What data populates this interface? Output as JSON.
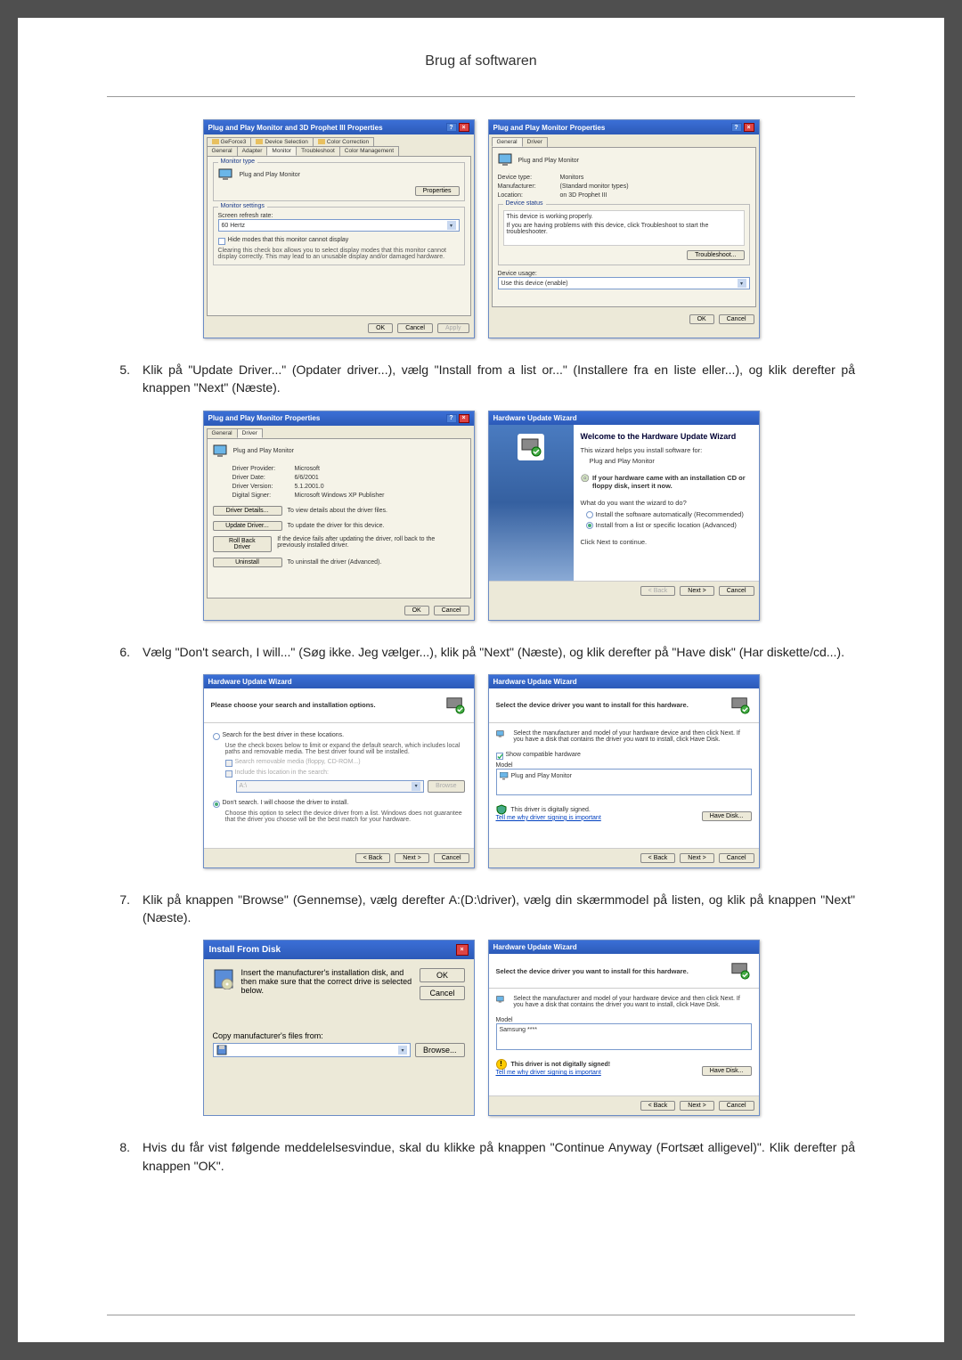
{
  "page": {
    "title": "Brug af softwaren"
  },
  "steps": {
    "s5": {
      "num": "5.",
      "text": "Klik på \"Update Driver...\" (Opdater driver...), vælg \"Install from a list or...\" (Installere fra en liste eller...), og klik derefter på knappen \"Next\" (Næste)."
    },
    "s6": {
      "num": "6.",
      "text": "Vælg \"Don't search, I will...\" (Søg ikke. Jeg vælger...), klik på \"Next\" (Næste), og klik derefter på \"Have disk\" (Har diskette/cd...)."
    },
    "s7": {
      "num": "7.",
      "text": "Klik på knappen \"Browse\" (Gennemse), vælg derefter A:(D:\\driver), vælg din skærmmodel på listen, og klik på knappen \"Next\" (Næste)."
    },
    "s8": {
      "num": "8.",
      "text": "Hvis du får vist følgende meddelelsesvindue, skal du klikke på knappen \"Continue Anyway (Fortsæt alligevel)\". Klik derefter på knappen \"OK\"."
    }
  },
  "fig1": {
    "left": {
      "title": "Plug and Play Monitor and 3D Prophet III Properties",
      "tabs": {
        "geforce": "GeForce3",
        "device_sel": "Device Selection",
        "color_corr": "Color Correction",
        "general": "General",
        "adapter": "Adapter",
        "monitor": "Monitor",
        "troubleshoot": "Troubleshoot",
        "color_mgmt": "Color Management"
      },
      "monitor_type_legend": "Monitor type",
      "monitor_name": "Plug and Play Monitor",
      "properties_btn": "Properties",
      "monitor_settings_legend": "Monitor settings",
      "refresh_label": "Screen refresh rate:",
      "refresh_value": "60 Hertz",
      "hide_modes": "Hide modes that this monitor cannot display",
      "hide_modes_note": "Clearing this check box allows you to select display modes that this monitor cannot display correctly. This may lead to an unusable display and/or damaged hardware.",
      "ok": "OK",
      "cancel": "Cancel",
      "apply": "Apply"
    },
    "right": {
      "title": "Plug and Play Monitor Properties",
      "tab_general": "General",
      "tab_driver": "Driver",
      "header": "Plug and Play Monitor",
      "devtype_lbl": "Device type:",
      "devtype_val": "Monitors",
      "manuf_lbl": "Manufacturer:",
      "manuf_val": "(Standard monitor types)",
      "loc_lbl": "Location:",
      "loc_val": "on 3D Prophet III",
      "status_legend": "Device status",
      "status_line1": "This device is working properly.",
      "status_line2": "If you are having problems with this device, click Troubleshoot to start the troubleshooter.",
      "troubleshoot_btn": "Troubleshoot...",
      "usage_lbl": "Device usage:",
      "usage_val": "Use this device (enable)",
      "ok": "OK",
      "cancel": "Cancel"
    }
  },
  "fig2": {
    "left": {
      "title": "Plug and Play Monitor Properties",
      "tab_general": "General",
      "tab_driver": "Driver",
      "header": "Plug and Play Monitor",
      "provider_lbl": "Driver Provider:",
      "provider_val": "Microsoft",
      "date_lbl": "Driver Date:",
      "date_val": "6/6/2001",
      "version_lbl": "Driver Version:",
      "version_val": "5.1.2001.0",
      "signer_lbl": "Digital Signer:",
      "signer_val": "Microsoft Windows XP Publisher",
      "details_btn": "Driver Details...",
      "details_txt": "To view details about the driver files.",
      "update_btn": "Update Driver...",
      "update_txt": "To update the driver for this device.",
      "rollback_btn": "Roll Back Driver",
      "rollback_txt": "If the device fails after updating the driver, roll back to the previously installed driver.",
      "uninstall_btn": "Uninstall",
      "uninstall_txt": "To uninstall the driver (Advanced).",
      "ok": "OK",
      "cancel": "Cancel"
    },
    "right": {
      "title": "Hardware Update Wizard",
      "welcome": "Welcome to the Hardware Update Wizard",
      "helps": "This wizard helps you install software for:",
      "device": "Plug and Play Monitor",
      "cd_hint": "If your hardware came with an installation CD or floppy disk, insert it now.",
      "question": "What do you want the wizard to do?",
      "opt_auto": "Install the software automatically (Recommended)",
      "opt_list": "Install from a list or specific location (Advanced)",
      "continue": "Click Next to continue.",
      "back": "< Back",
      "next": "Next >",
      "cancel": "Cancel"
    }
  },
  "fig3": {
    "left": {
      "title": "Hardware Update Wizard",
      "header": "Please choose your search and installation options.",
      "opt_search": "Search for the best driver in these locations.",
      "search_note": "Use the check boxes below to limit or expand the default search, which includes local paths and removable media. The best driver found will be installed.",
      "chk_removable": "Search removable media (floppy, CD-ROM...)",
      "chk_include": "Include this location in the search:",
      "path": "A:\\",
      "browse": "Browse",
      "opt_dont": "Don't search. I will choose the driver to install.",
      "dont_note": "Choose this option to select the device driver from a list. Windows does not guarantee that the driver you choose will be the best match for your hardware.",
      "back": "< Back",
      "next": "Next >",
      "cancel": "Cancel"
    },
    "right": {
      "title": "Hardware Update Wizard",
      "header": "Select the device driver you want to install for this hardware.",
      "instr": "Select the manufacturer and model of your hardware device and then click Next. If you have a disk that contains the driver you want to install, click Have Disk.",
      "show_compat": "Show compatible hardware",
      "model_lbl": "Model",
      "model_item": "Plug and Play Monitor",
      "signed": "This driver is digitally signed.",
      "tellme": "Tell me why driver signing is important",
      "have_disk": "Have Disk...",
      "back": "< Back",
      "next": "Next >",
      "cancel": "Cancel"
    }
  },
  "fig4": {
    "left": {
      "title": "Install From Disk",
      "instr": "Insert the manufacturer's installation disk, and then make sure that the correct drive is selected below.",
      "ok": "OK",
      "cancel": "Cancel",
      "copy_lbl": "Copy manufacturer's files from:",
      "path_val": "",
      "browse": "Browse..."
    },
    "right": {
      "title": "Hardware Update Wizard",
      "header": "Select the device driver you want to install for this hardware.",
      "instr": "Select the manufacturer and model of your hardware device and then click Next. If you have a disk that contains the driver you want to install, click Have Disk.",
      "model_lbl": "Model",
      "model_item": "Samsung ****",
      "not_signed": "This driver is not digitally signed!",
      "tellme": "Tell me why driver signing is important",
      "have_disk": "Have Disk...",
      "back": "< Back",
      "next": "Next >",
      "cancel": "Cancel"
    }
  }
}
